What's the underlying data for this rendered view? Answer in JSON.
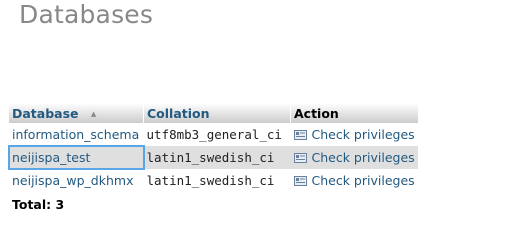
{
  "page": {
    "title": "Databases"
  },
  "table": {
    "headers": {
      "database": "Database",
      "collation": "Collation",
      "action": "Action"
    },
    "sort": {
      "column": "database",
      "direction": "ascending",
      "icon": "sort-ascending-icon"
    },
    "rows": [
      {
        "name": "information_schema",
        "collation": "utf8mb3_general_ci",
        "action": "Check privileges",
        "selected": false
      },
      {
        "name": "neijispa_test",
        "collation": "latin1_swedish_ci",
        "action": "Check privileges",
        "selected": true
      },
      {
        "name": "neijispa_wp_dkhmx",
        "collation": "latin1_swedish_ci",
        "action": "Check privileges",
        "selected": false
      }
    ],
    "total_label": "Total: 3"
  },
  "colors": {
    "link": "#235a81",
    "title": "#888888",
    "row_alt": "#dfdfdf",
    "selection_outline": "#5aa5e6"
  }
}
